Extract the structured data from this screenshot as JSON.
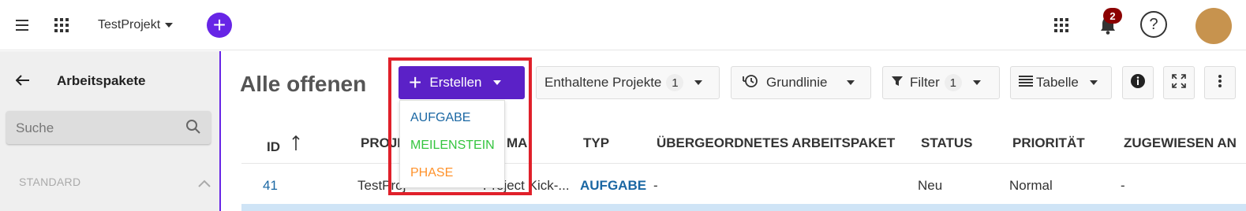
{
  "header": {
    "project_name": "TestProjekt",
    "notifications_count": "2",
    "help_label": "?",
    "colors": {
      "accent": "#6725e6",
      "badge": "#8b0000",
      "avatar": "#c7934e"
    }
  },
  "sidebar": {
    "title": "Arbeitspakete",
    "search_placeholder": "Suche",
    "section_label": "STANDARD"
  },
  "main": {
    "title": "Alle offenen",
    "toolbar": {
      "create_label": "Erstellen",
      "projects_label": "Enthaltene Projekte",
      "projects_count": "1",
      "baseline_label": "Grundlinie",
      "filter_label": "Filter",
      "filter_count": "1",
      "table_label": "Tabelle"
    },
    "create_menu": [
      {
        "label": "AUFGABE",
        "color": "#1a67a3"
      },
      {
        "label": "MEILENSTEIN",
        "color": "#35c53f"
      },
      {
        "label": "PHASE",
        "color": "#ff922b"
      }
    ],
    "table": {
      "columns": {
        "id": "ID",
        "project": "PROJE",
        "subject": "MA",
        "type": "TYP",
        "parent": "ÜBERGEORDNETES ARBEITSPAKET",
        "status": "STATUS",
        "priority": "PRIORITÄT",
        "assignee": "ZUGEWIESEN AN"
      },
      "rows": [
        {
          "id": "41",
          "project": "TestProj",
          "subject": "Project Kick-...",
          "type": "AUFGABE",
          "parent": "-",
          "status": "Neu",
          "priority": "Normal",
          "assignee": "-"
        }
      ]
    }
  }
}
